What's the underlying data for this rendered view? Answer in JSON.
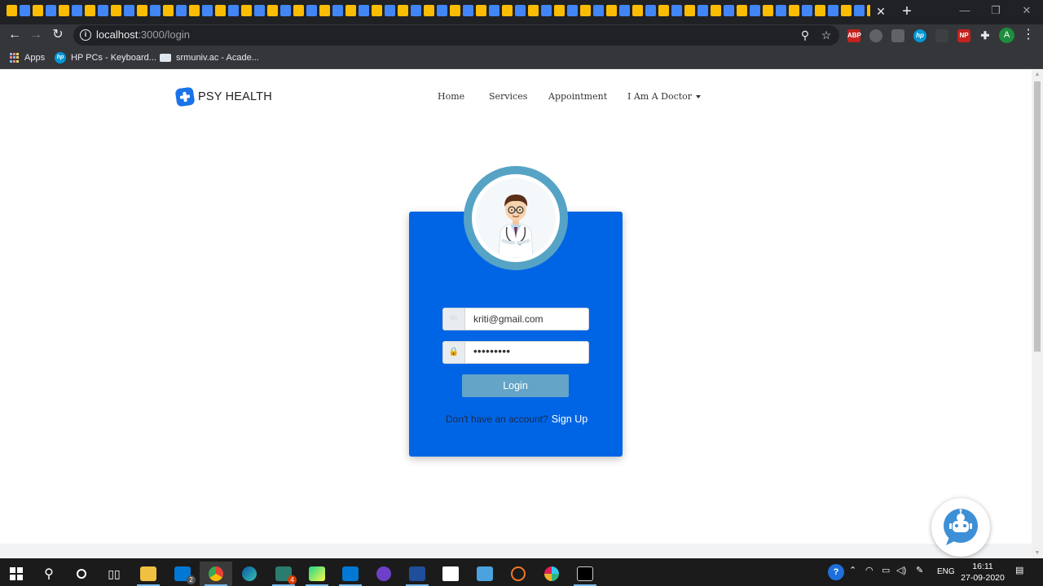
{
  "browser": {
    "tab_close": "✕",
    "new_tab": "+",
    "window": {
      "minimize": "—",
      "maximize": "❐",
      "close": "✕"
    },
    "url_host": "localhost",
    "url_path": ":3000/login",
    "profile_initial": "A",
    "extensions": [
      "ABP",
      "",
      "",
      "hp",
      "",
      "NP",
      "",
      ""
    ],
    "bookmarks": [
      {
        "label": "Apps"
      },
      {
        "label": "HP PCs - Keyboard..."
      },
      {
        "label": "srmuniv.ac - Acade..."
      }
    ]
  },
  "site": {
    "brand": "PSY HEALTH",
    "nav": {
      "home": "Home",
      "services": "Services",
      "appointment": "Appointment",
      "doctor": "I Am A Doctor"
    }
  },
  "login": {
    "email": "kriti@gmail.com",
    "password": "•••••••••",
    "email_icon": "✉",
    "password_icon": "🔒",
    "submit": "Login",
    "signup_prompt": "Don't have an account?",
    "signup_link": "Sign Up"
  },
  "taskbar": {
    "mail_badge": "2",
    "app_badge": "4",
    "language": "ENG",
    "time": "16:11",
    "date": "27-09-2020"
  },
  "colors": {
    "card": "#0065e5",
    "login_button": "#63a4c7",
    "avatar_ring": "#56a3c5",
    "chrome_dark": "#202124"
  }
}
